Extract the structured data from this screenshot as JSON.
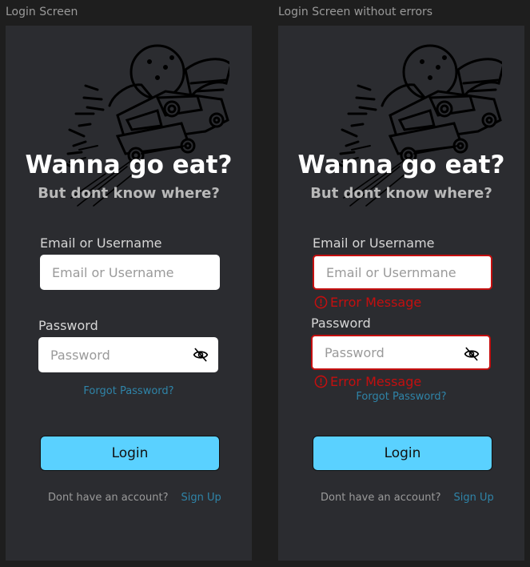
{
  "frames": {
    "left": {
      "label": "Login Screen"
    },
    "right": {
      "label": "Login Screen without errors"
    }
  },
  "screen": {
    "title": "Wanna go eat?",
    "subtitle": "But dont know where?",
    "email_label": "Email or Username",
    "email_placeholder": "Email or Username",
    "email_placeholder_error": "Email or Usernmane",
    "password_label": "Password",
    "password_placeholder": "Password",
    "forgot_password": "Forgot Password?",
    "login_button": "Login",
    "no_account_text": "Dont have an account?",
    "signup_link": "Sign Up",
    "error_message": "Error Message"
  },
  "icons": {
    "eye": "eye-slash-icon",
    "error": "alert-circle-icon",
    "illustration": "food-car-illustration"
  },
  "colors": {
    "background": "#1e1e1e",
    "frame": "#2b2c30",
    "accent": "#5ad1ff",
    "link": "#2f84a8",
    "error": "#c40f0f"
  }
}
